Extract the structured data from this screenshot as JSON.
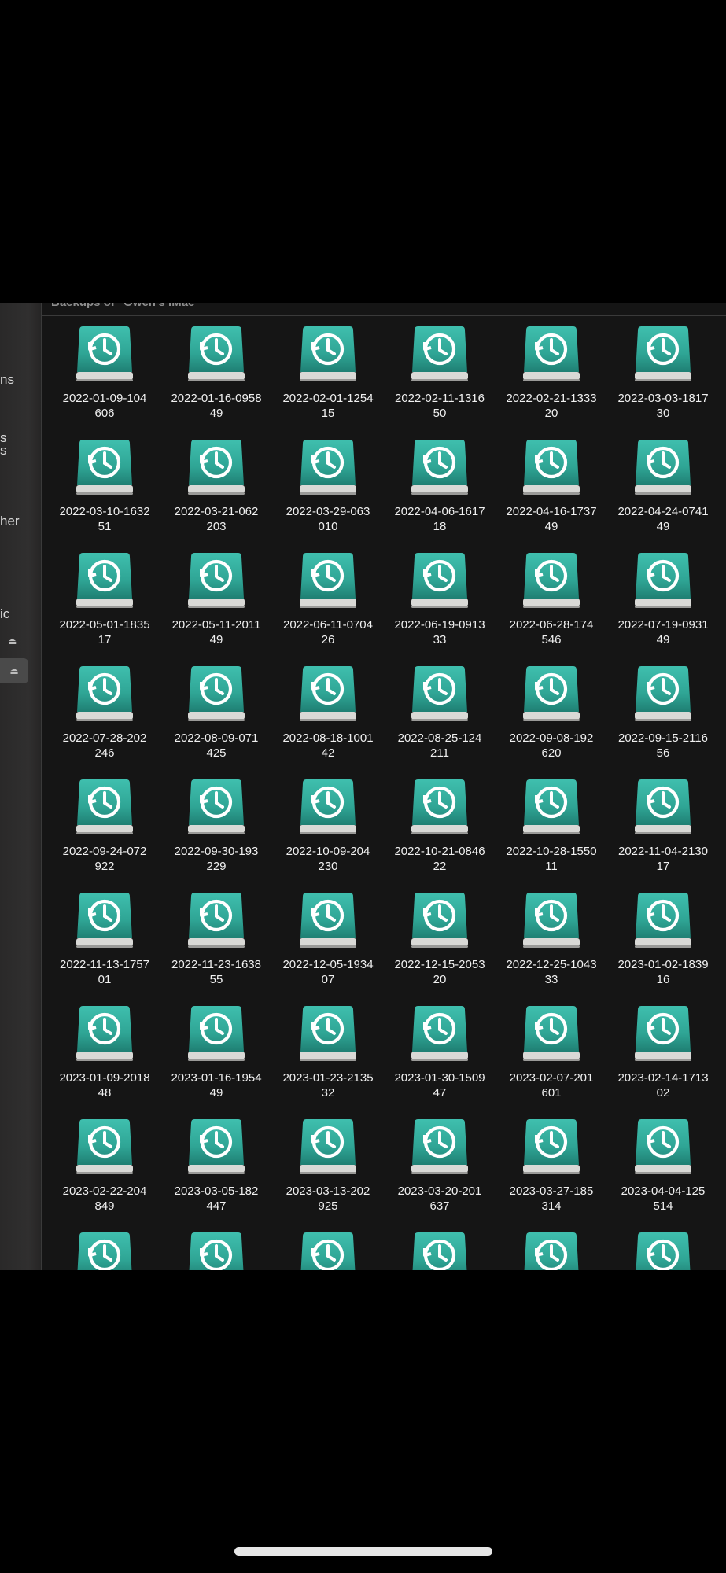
{
  "window": {
    "header_title": "Backups of \"Owen's iMac\"",
    "sidebar_fragments": [
      "ns",
      "s",
      "s",
      "her",
      "ic"
    ]
  },
  "icons": {
    "backup_item": "time-machine-drive-icon",
    "eject": "eject-icon"
  },
  "colors": {
    "drive_accent": "#2fa595",
    "background": "#151515",
    "sidebar": "#2e2d2d"
  },
  "backups": [
    {
      "line1": "2022-01-09-104",
      "line2": "606"
    },
    {
      "line1": "2022-01-16-0958",
      "line2": "49"
    },
    {
      "line1": "2022-02-01-1254",
      "line2": "15"
    },
    {
      "line1": "2022-02-11-1316",
      "line2": "50"
    },
    {
      "line1": "2022-02-21-1333",
      "line2": "20"
    },
    {
      "line1": "2022-03-03-1817",
      "line2": "30"
    },
    {
      "line1": "2022-03-10-1632",
      "line2": "51"
    },
    {
      "line1": "2022-03-21-062",
      "line2": "203"
    },
    {
      "line1": "2022-03-29-063",
      "line2": "010"
    },
    {
      "line1": "2022-04-06-1617",
      "line2": "18"
    },
    {
      "line1": "2022-04-16-1737",
      "line2": "49"
    },
    {
      "line1": "2022-04-24-0741",
      "line2": "49"
    },
    {
      "line1": "2022-05-01-1835",
      "line2": "17"
    },
    {
      "line1": "2022-05-11-2011",
      "line2": "49"
    },
    {
      "line1": "2022-06-11-0704",
      "line2": "26"
    },
    {
      "line1": "2022-06-19-0913",
      "line2": "33"
    },
    {
      "line1": "2022-06-28-174",
      "line2": "546"
    },
    {
      "line1": "2022-07-19-0931",
      "line2": "49"
    },
    {
      "line1": "2022-07-28-202",
      "line2": "246"
    },
    {
      "line1": "2022-08-09-071",
      "line2": "425"
    },
    {
      "line1": "2022-08-18-1001",
      "line2": "42"
    },
    {
      "line1": "2022-08-25-124",
      "line2": "211"
    },
    {
      "line1": "2022-09-08-192",
      "line2": "620"
    },
    {
      "line1": "2022-09-15-2116",
      "line2": "56"
    },
    {
      "line1": "2022-09-24-072",
      "line2": "922"
    },
    {
      "line1": "2022-09-30-193",
      "line2": "229"
    },
    {
      "line1": "2022-10-09-204",
      "line2": "230"
    },
    {
      "line1": "2022-10-21-0846",
      "line2": "22"
    },
    {
      "line1": "2022-10-28-1550",
      "line2": "11"
    },
    {
      "line1": "2022-11-04-2130",
      "line2": "17"
    },
    {
      "line1": "2022-11-13-1757",
      "line2": "01"
    },
    {
      "line1": "2022-11-23-1638",
      "line2": "55"
    },
    {
      "line1": "2022-12-05-1934",
      "line2": "07"
    },
    {
      "line1": "2022-12-15-2053",
      "line2": "20"
    },
    {
      "line1": "2022-12-25-1043",
      "line2": "33"
    },
    {
      "line1": "2023-01-02-1839",
      "line2": "16"
    },
    {
      "line1": "2023-01-09-2018",
      "line2": "48"
    },
    {
      "line1": "2023-01-16-1954",
      "line2": "49"
    },
    {
      "line1": "2023-01-23-2135",
      "line2": "32"
    },
    {
      "line1": "2023-01-30-1509",
      "line2": "47"
    },
    {
      "line1": "2023-02-07-201",
      "line2": "601"
    },
    {
      "line1": "2023-02-14-1713",
      "line2": "02"
    },
    {
      "line1": "2023-02-22-204",
      "line2": "849"
    },
    {
      "line1": "2023-03-05-182",
      "line2": "447"
    },
    {
      "line1": "2023-03-13-202",
      "line2": "925"
    },
    {
      "line1": "2023-03-20-201",
      "line2": "637"
    },
    {
      "line1": "2023-03-27-185",
      "line2": "314"
    },
    {
      "line1": "2023-04-04-125",
      "line2": "514"
    },
    {
      "line1": "",
      "line2": ""
    },
    {
      "line1": "",
      "line2": ""
    },
    {
      "line1": "",
      "line2": ""
    },
    {
      "line1": "",
      "line2": ""
    },
    {
      "line1": "",
      "line2": ""
    },
    {
      "line1": "",
      "line2": ""
    }
  ]
}
